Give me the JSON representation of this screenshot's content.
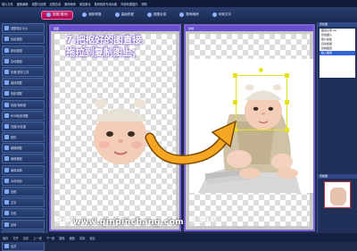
{
  "menubar": {
    "items": [
      "相片文件",
      "图像编辑",
      "调整与处理",
      "滤镜合成",
      "数码暗房",
      "美容美化",
      "数码相机专用功能",
      "外部效果插件",
      "帮助"
    ]
  },
  "toolbar": {
    "logo": "光影魔术手",
    "buttons": [
      {
        "label": "抠图(撤消)",
        "active": true,
        "icon": "scissors-icon"
      },
      {
        "label": "裁剪修复",
        "active": false,
        "icon": "crop-icon"
      },
      {
        "label": "高级修复",
        "active": false,
        "icon": "wand-icon"
      },
      {
        "label": "抠图合成",
        "active": false,
        "icon": "layers-icon"
      },
      {
        "label": "数码暗房",
        "active": false,
        "icon": "camera-icon"
      },
      {
        "label": "玩转文字",
        "active": false,
        "icon": "text-icon"
      }
    ]
  },
  "sidebar": {
    "items": [
      "调整相片大小",
      "自由抠图",
      "颜色抠图",
      "自动抠图",
      "色差/变形工具",
      "曲线调整",
      "色阶调整",
      "色相/饱和度",
      "RGB色彩调整",
      "亮度/对比度",
      "锐化",
      "模糊调整",
      "局部抠图",
      "局部涂鸦",
      "水印添加",
      "边框",
      "文字",
      "去色",
      "反转",
      "设置相框/图层效果",
      "合并"
    ]
  },
  "instruction": {
    "line1": "7.把抠好的图直接",
    "line2": "拖拉到复制图上；"
  },
  "left_panel": {
    "title": "抠图",
    "zoom": "30%"
  },
  "right_canvas": {
    "title": "复制",
    "zoom": "139%"
  },
  "right_panel": {
    "header": "查找图",
    "list": [
      "图层记录 (6)",
      "原始图片",
      "照片模板",
      "自动抠图",
      "复制图层",
      "贴入图层"
    ],
    "selected_index": 5,
    "navigator_label": "导航器"
  },
  "statusbar": {
    "items": [
      "保存",
      "打开",
      "另存",
      "上一张",
      "下一张",
      "旋转",
      "缩放",
      "实际",
      "适合"
    ]
  },
  "watermark": "www.qinpinchang.com",
  "colors": {
    "accent": "#d51c6b",
    "panel_border": "#7b61d4",
    "arrow": "#f5a623",
    "selection": "#e6e21a"
  }
}
